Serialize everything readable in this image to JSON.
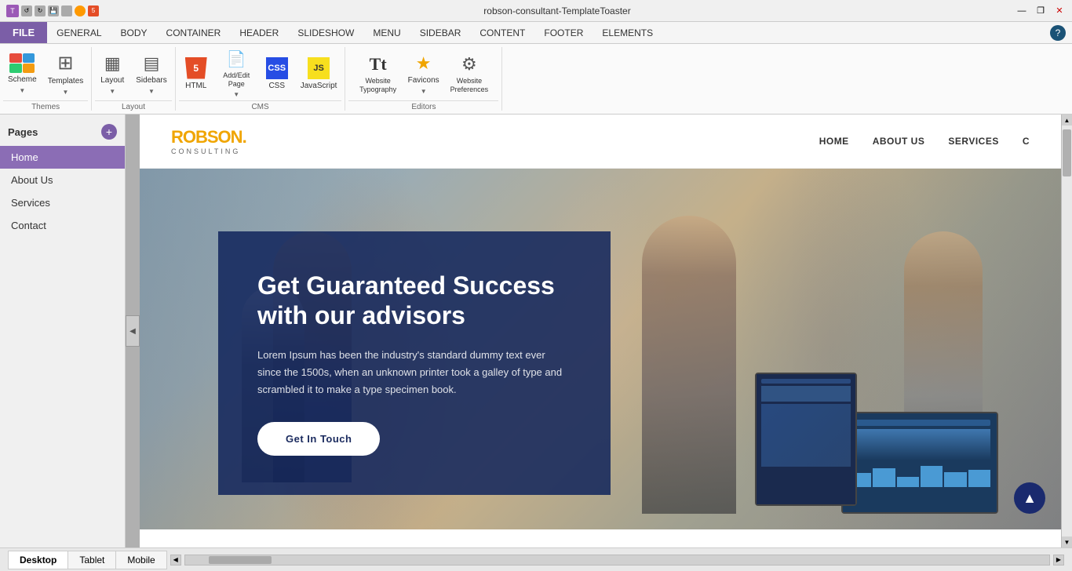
{
  "titleBar": {
    "title": "robson-consultant-TemplateToaster",
    "minimize": "—",
    "restore": "❐",
    "close": "✕"
  },
  "menuBar": {
    "file": "FILE",
    "items": [
      "GENERAL",
      "BODY",
      "CONTAINER",
      "HEADER",
      "SLIDESHOW",
      "MENU",
      "SIDEBAR",
      "CONTENT",
      "FOOTER",
      "ELEMENTS"
    ]
  },
  "ribbon": {
    "groups": [
      {
        "label": "Themes",
        "items": [
          {
            "id": "scheme",
            "label": "Scheme",
            "type": "scheme"
          },
          {
            "id": "templates",
            "label": "Templates",
            "type": "templates"
          }
        ]
      },
      {
        "label": "Layout",
        "items": [
          {
            "id": "layout",
            "label": "Layout",
            "type": "icon"
          },
          {
            "id": "sidebars",
            "label": "Sidebars",
            "type": "icon"
          }
        ]
      },
      {
        "label": "CMS",
        "items": [
          {
            "id": "html",
            "label": "HTML",
            "type": "html5"
          },
          {
            "id": "add-edit",
            "label": "Add/Edit Page",
            "type": "icon"
          },
          {
            "id": "css",
            "label": "CSS",
            "type": "css"
          },
          {
            "id": "javascript",
            "label": "JavaScript",
            "type": "js"
          }
        ]
      },
      {
        "label": "Editors",
        "items": [
          {
            "id": "typography",
            "label": "Website Typography",
            "type": "tt"
          },
          {
            "id": "favicons",
            "label": "Favicons",
            "type": "star"
          },
          {
            "id": "preferences",
            "label": "Website Preferences",
            "type": "gear"
          }
        ]
      }
    ]
  },
  "sidebar": {
    "title": "Pages",
    "addButton": "+",
    "pages": [
      {
        "id": "home",
        "label": "Home",
        "active": true
      },
      {
        "id": "about",
        "label": "About Us",
        "active": false
      },
      {
        "id": "services",
        "label": "Services",
        "active": false
      },
      {
        "id": "contact",
        "label": "Contact",
        "active": false
      }
    ]
  },
  "siteNav": {
    "logoName": "ROBSON",
    "logoDot": ".",
    "logoSub": "CONSULTING",
    "links": [
      "HOME",
      "ABOUT US",
      "SERVICES",
      "C"
    ]
  },
  "hero": {
    "title": "Get Guaranteed Success with our advisors",
    "description": "Lorem Ipsum has been the industry's standard dummy text ever since the 1500s, when an unknown printer took a galley of type and scrambled it to make a type specimen book.",
    "buttonLabel": "Get In Touch"
  },
  "bottomBar": {
    "tabs": [
      {
        "id": "desktop",
        "label": "Desktop",
        "active": true
      },
      {
        "id": "tablet",
        "label": "Tablet",
        "active": false
      },
      {
        "id": "mobile",
        "label": "Mobile",
        "active": false
      }
    ]
  },
  "colors": {
    "accent": "#7b5ea7",
    "heroOverlay": "rgba(15,35,90,0.85)",
    "navbarBg": "#1a2a6e"
  }
}
